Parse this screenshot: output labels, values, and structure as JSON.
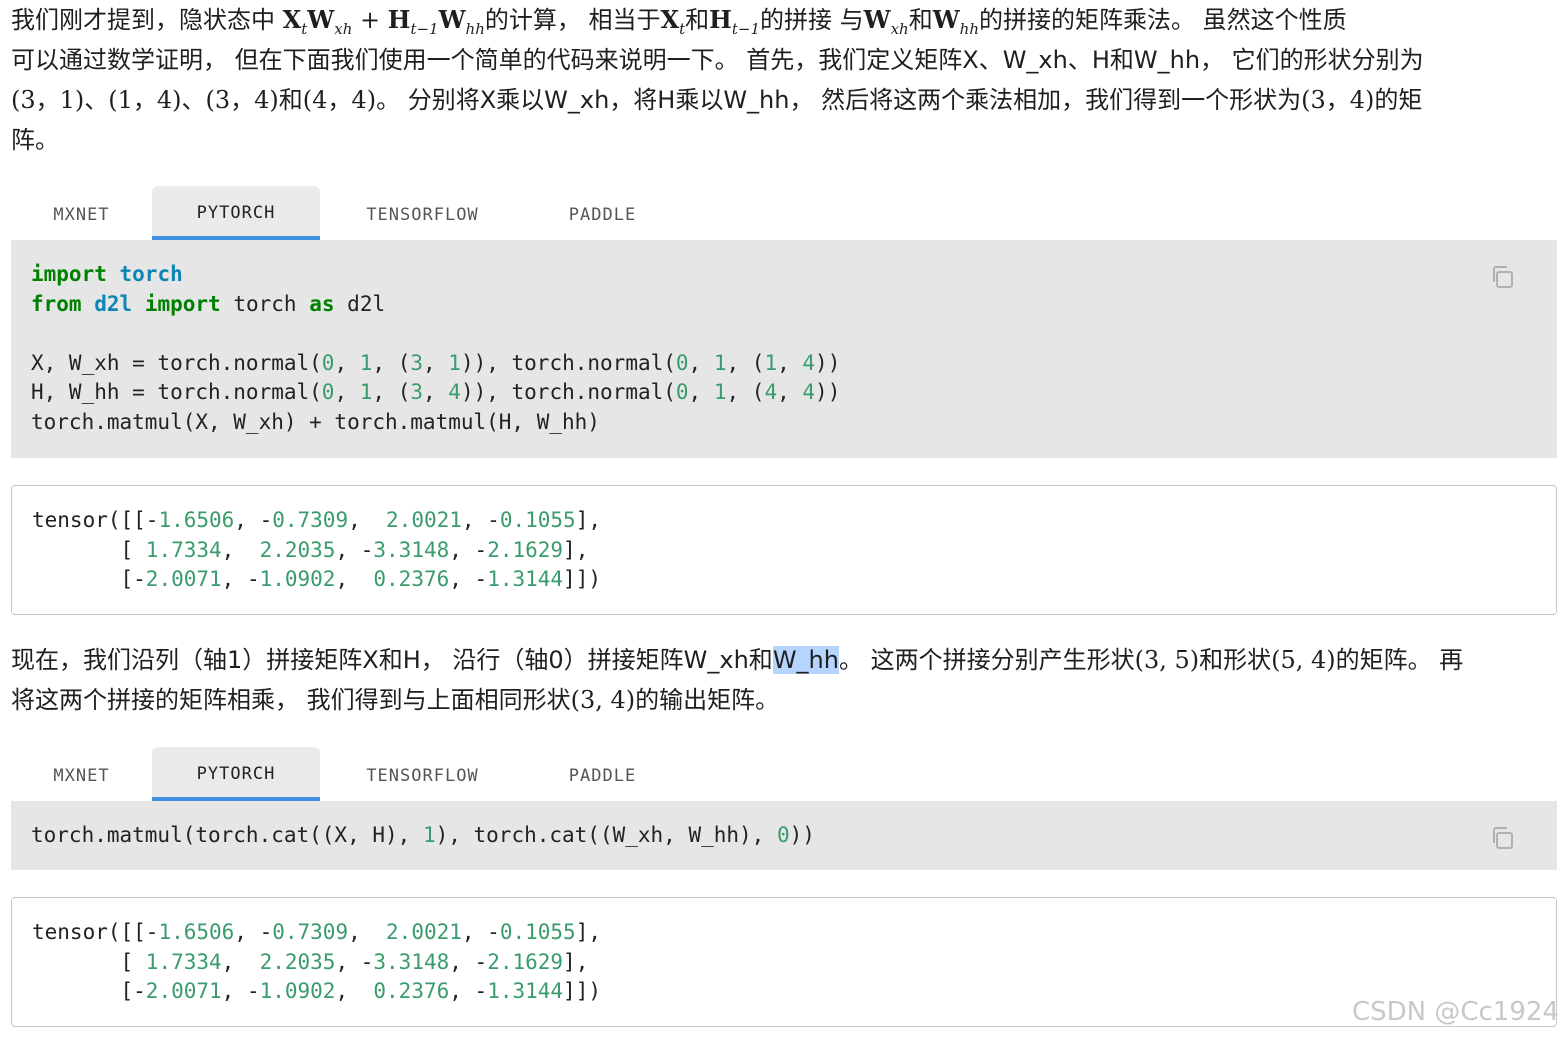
{
  "paragraph1": {
    "line1": {
      "t1": "我们刚才提到，隐状态中 ",
      "X": "X",
      "X_sub": "t",
      "W1": "W",
      "W1_sub": "xh",
      "plus": " + ",
      "H": "H",
      "H_sub": "t−1",
      "W2": "W",
      "W2_sub": "hh",
      "t2": "的计算， 相当于",
      "X2": "X",
      "X2_sub": "t",
      "and1": "和",
      "H2": "H",
      "H2_sub": "t−1",
      "t3": "的拼接 与",
      "W3": "W",
      "W3_sub": "xh",
      "and2": "和",
      "W4": "W",
      "W4_sub": "hh",
      "t4": "的拼接的矩阵乘法。 虽然这个性质"
    },
    "line2": "可以通过数学证明， 但在下面我们使用一个简单的代码来说明一下。 首先，我们定义矩阵X、W_xh、H和W_hh， 它们的形状分别为",
    "line3": {
      "s1": "(3，1)",
      "sep1": "、",
      "s2": "(1，4)",
      "sep2": "、",
      "s3": "(3，4)",
      "and": "和",
      "s4": "(4，4)",
      "t1": "。 分别将X乘以W_xh，将H乘以W_hh， 然后将这两个乘法相加，我们得到一个形状为",
      "s5": "(3，4)",
      "t2": "的矩"
    },
    "line4": "阵。"
  },
  "tabs1": {
    "items": [
      "MXNET",
      "PYTORCH",
      "TENSORFLOW",
      "PADDLE"
    ],
    "active": "PYTORCH"
  },
  "code1": {
    "lines": [
      "import torch",
      "from d2l import torch as d2l",
      "",
      "X, W_xh = torch.normal(0, 1, (3, 1)), torch.normal(0, 1, (1, 4))",
      "H, W_hh = torch.normal(0, 1, (3, 4)), torch.normal(0, 1, (4, 4))",
      "torch.matmul(X, W_xh) + torch.matmul(H, W_hh)"
    ]
  },
  "output1": {
    "prefix": "tensor(",
    "rows": [
      [
        "-1.6506",
        "-0.7309",
        "2.0021",
        "-0.1055"
      ],
      [
        "1.7334",
        "2.2035",
        "-3.3148",
        "-2.1629"
      ],
      [
        "-2.0071",
        "-1.0902",
        "0.2376",
        "-1.3144"
      ]
    ]
  },
  "paragraph2": {
    "line1": {
      "t1": "现在，我们沿列（轴1）拼接矩阵X和H， 沿行（轴0）拼接矩阵W_xh和",
      "selected": "W_hh",
      "t2": "。 这两个拼接分别产生形状",
      "s1": "(3, 5)",
      "t3": "和形状",
      "s2": "(5, 4)",
      "t4": "的矩阵。 再"
    },
    "line2": {
      "t1": "将这两个拼接的矩阵相乘， 我们得到与上面相同形状",
      "s1": "(3, 4)",
      "t2": "的输出矩阵。"
    }
  },
  "tabs2": {
    "items": [
      "MXNET",
      "PYTORCH",
      "TENSORFLOW",
      "PADDLE"
    ],
    "active": "PYTORCH"
  },
  "code2": {
    "lines": [
      "torch.matmul(torch.cat((X, H), 1), torch.cat((W_xh, W_hh), 0))"
    ]
  },
  "output2": {
    "prefix": "tensor(",
    "rows": [
      [
        "-1.6506",
        "-0.7309",
        "2.0021",
        "-0.1055"
      ],
      [
        "1.7334",
        "2.2035",
        "-3.3148",
        "-2.1629"
      ],
      [
        "-2.0071",
        "-1.0902",
        "0.2376",
        "-1.3144"
      ]
    ]
  },
  "icons": {
    "copy": "copy-icon"
  },
  "watermark": "CSDN @Cc1924"
}
